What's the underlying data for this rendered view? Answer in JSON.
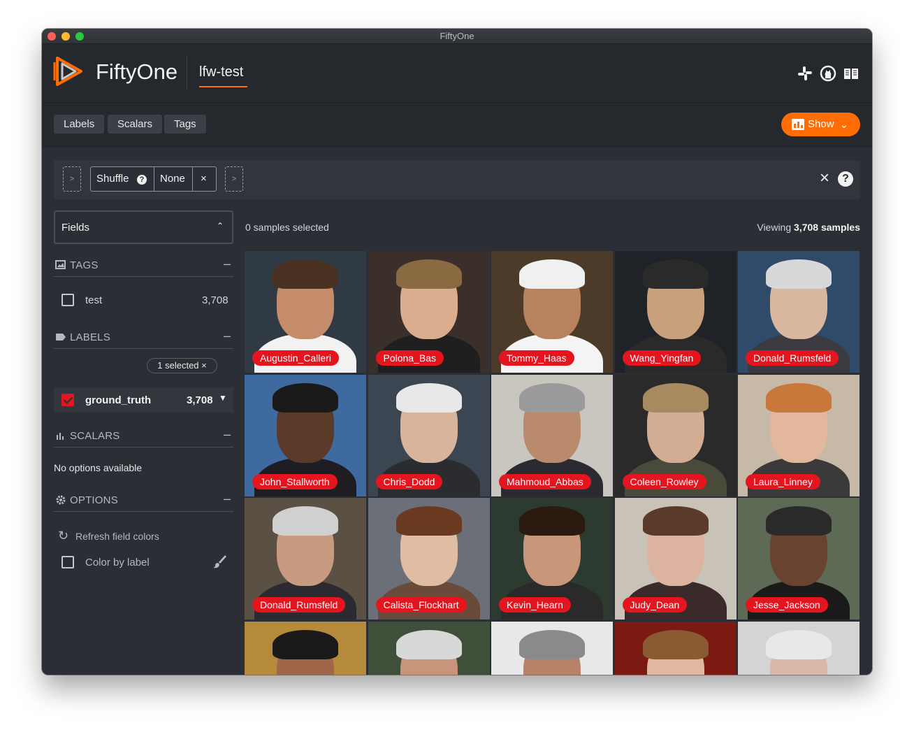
{
  "window": {
    "title": "FiftyOne"
  },
  "header": {
    "brand": "FiftyOne",
    "dataset_name": "lfw-test",
    "icons": [
      "slack-icon",
      "github-icon",
      "docs-book-icon"
    ],
    "accent_color": "#ff6d04"
  },
  "tabs": [
    {
      "label": "Labels"
    },
    {
      "label": "Scalars"
    },
    {
      "label": "Tags"
    }
  ],
  "show_button": {
    "label": "Show"
  },
  "view_bar": {
    "stage_name": "Shuffle",
    "stage_value": "None",
    "close_symbol": "×",
    "help_symbol": "?",
    "add_stage_symbol": ">"
  },
  "sidebar": {
    "fields_title": "Fields",
    "sections": {
      "tags": {
        "title": "TAGS",
        "items": [
          {
            "label": "test",
            "count": "3,708",
            "checked": false
          }
        ]
      },
      "labels": {
        "title": "LABELS",
        "selected_pill": "1 selected ×",
        "items": [
          {
            "label": "ground_truth",
            "count": "3,708",
            "checked": true,
            "color": "#e5151f"
          }
        ]
      },
      "scalars": {
        "title": "SCALARS",
        "empty_text": "No options available"
      },
      "options": {
        "title": "OPTIONS",
        "refresh_label": "Refresh field colors",
        "color_by_label": "Color by label"
      }
    }
  },
  "content": {
    "selected_text": "0 samples selected",
    "viewing_prefix": "Viewing",
    "viewing_count": "3,708 samples"
  },
  "samples": [
    {
      "label": "Augustin_Calleri"
    },
    {
      "label": "Polona_Bas"
    },
    {
      "label": "Tommy_Haas"
    },
    {
      "label": "Wang_Yingfan"
    },
    {
      "label": "Donald_Rumsfeld"
    },
    {
      "label": "John_Stallworth"
    },
    {
      "label": "Chris_Dodd"
    },
    {
      "label": "Mahmoud_Abbas"
    },
    {
      "label": "Coleen_Rowley"
    },
    {
      "label": "Laura_Linney"
    },
    {
      "label": "Donald_Rumsfeld"
    },
    {
      "label": "Calista_Flockhart"
    },
    {
      "label": "Kevin_Hearn"
    },
    {
      "label": "Judy_Dean"
    },
    {
      "label": "Jesse_Jackson"
    },
    {
      "label": ""
    },
    {
      "label": ""
    },
    {
      "label": ""
    },
    {
      "label": ""
    },
    {
      "label": ""
    }
  ]
}
